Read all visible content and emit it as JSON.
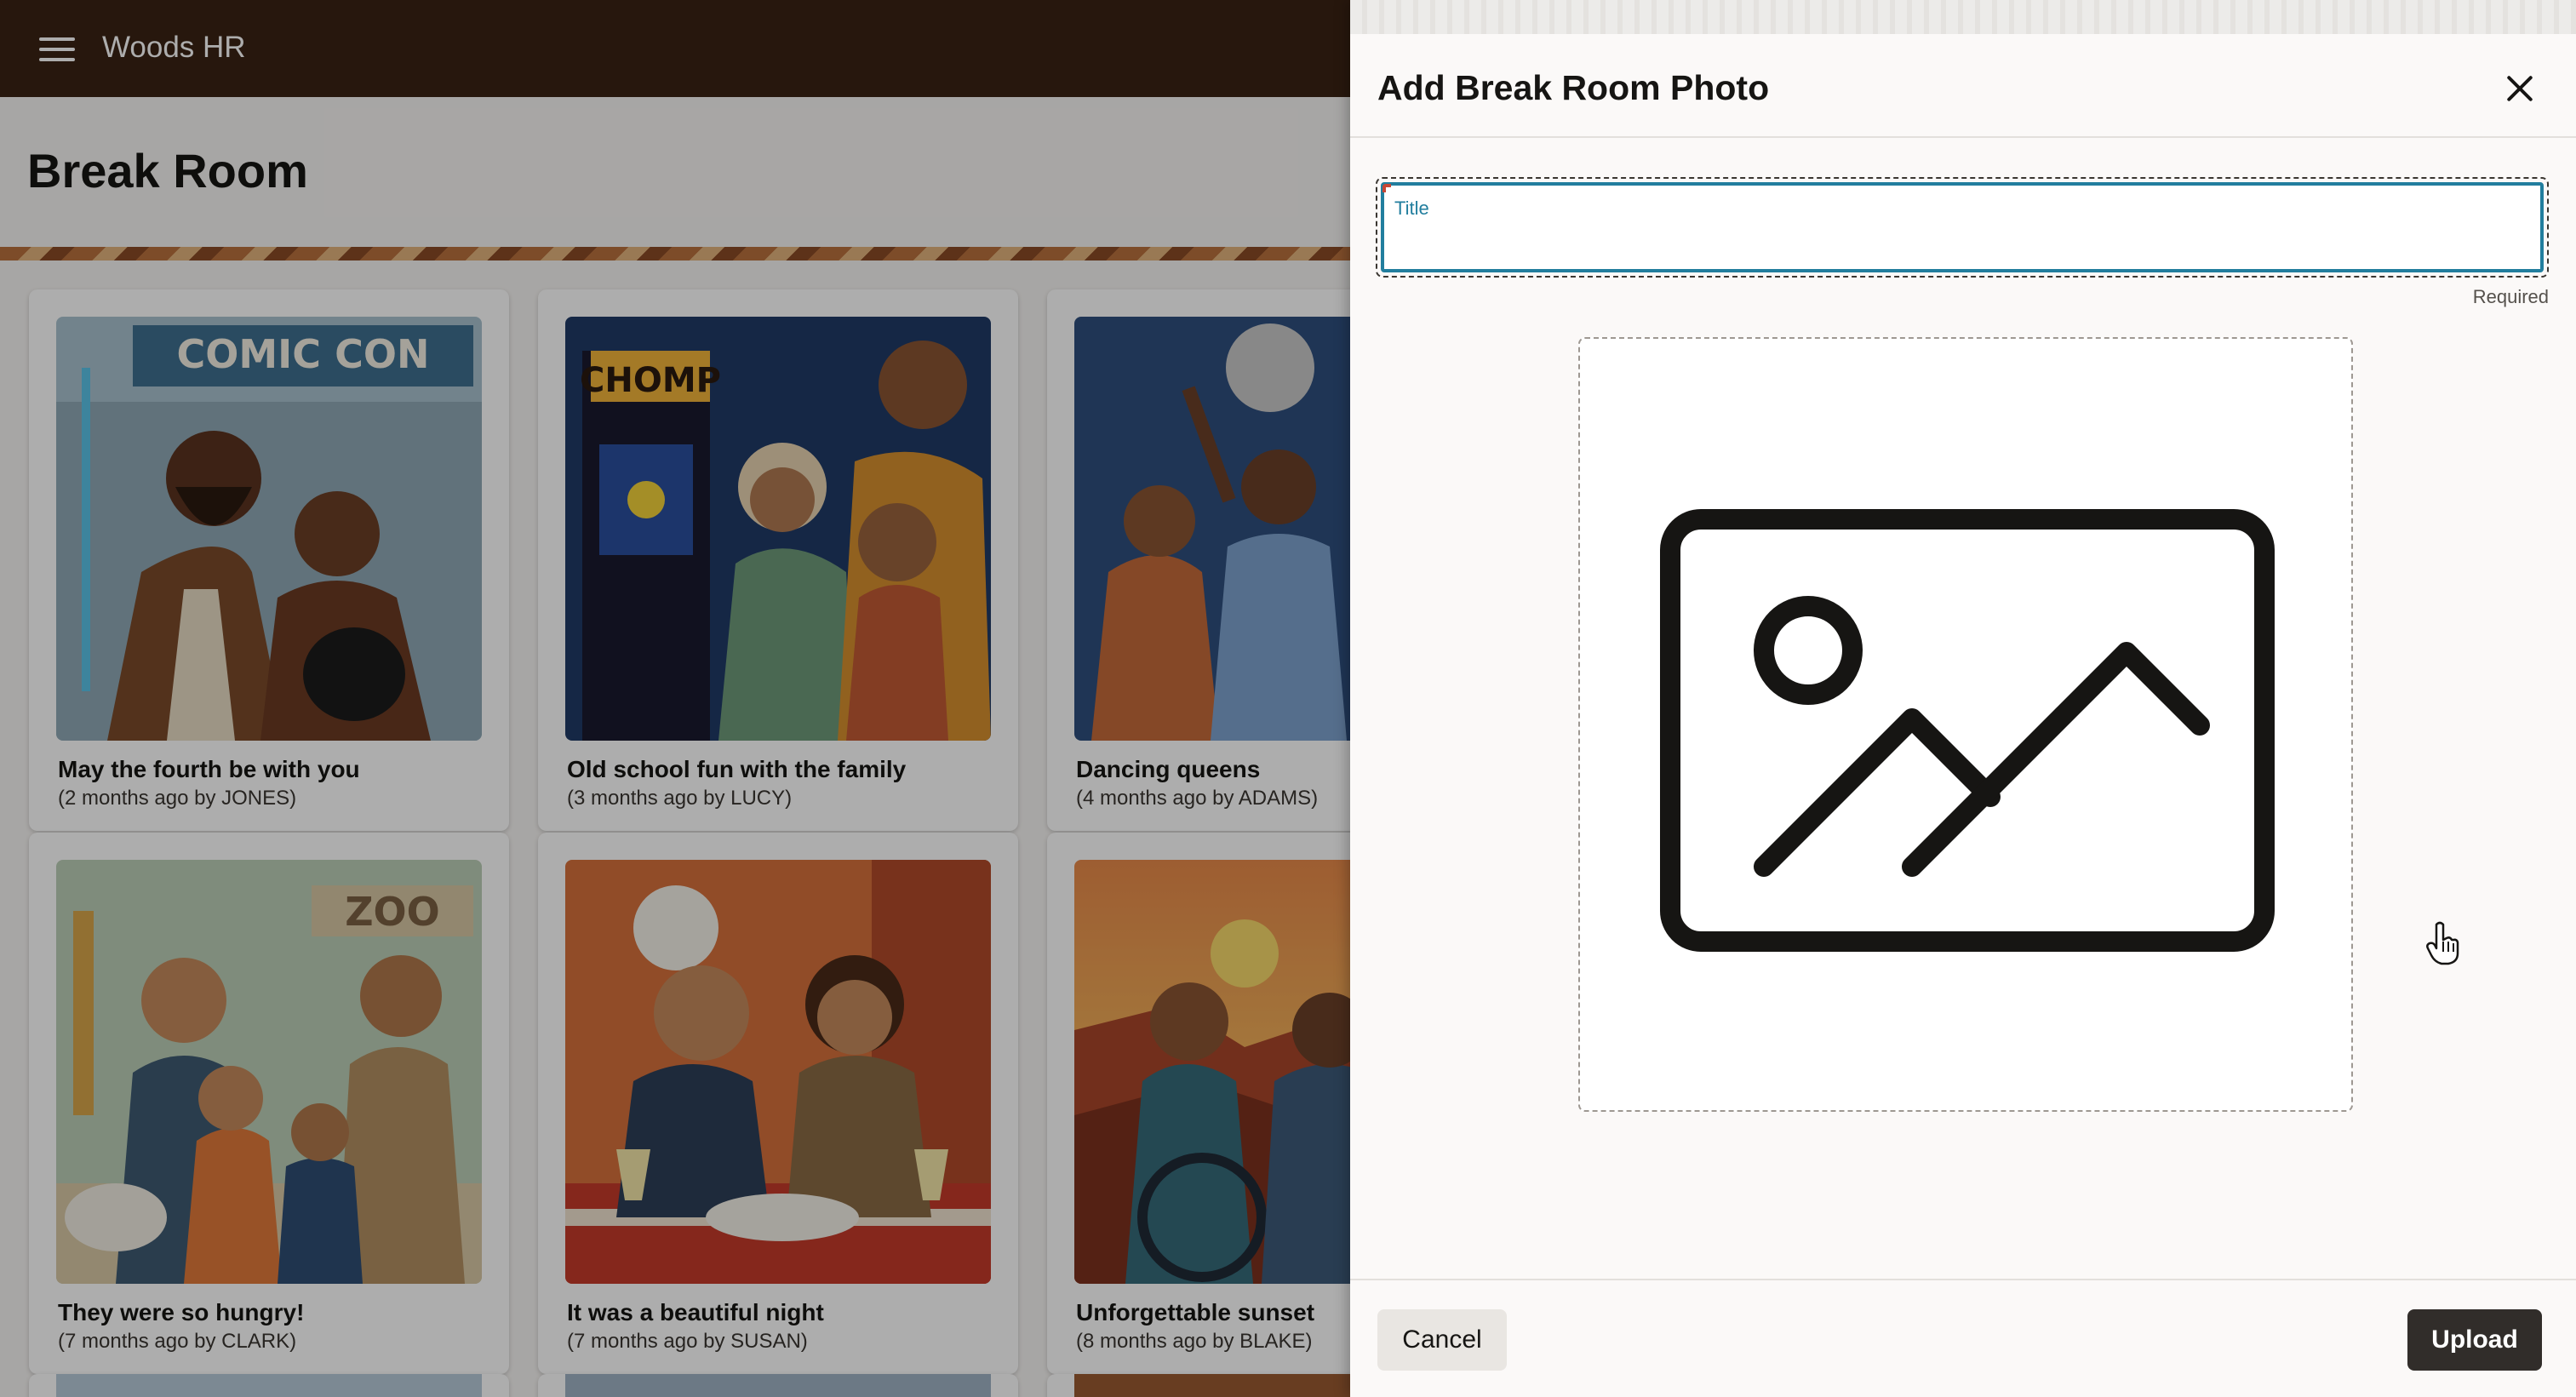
{
  "app": {
    "brand": "Woods HR",
    "page_title": "Break Room"
  },
  "cards": [
    {
      "title": "May the fourth be with you",
      "meta": "(2 months ago by JONES)",
      "illustration": "comic-con"
    },
    {
      "title": "Old school fun with the family",
      "meta": "(3 months ago by LUCY)",
      "illustration": "arcade",
      "sign": "CHOMP"
    },
    {
      "title": "Dancing queens",
      "meta": "(4 months ago by ADAMS)",
      "illustration": "disco"
    },
    {
      "title": "They were so hungry!",
      "meta": "(7 months ago by CLARK)",
      "illustration": "zoo",
      "sign": "ZOO"
    },
    {
      "title": "It was a beautiful night",
      "meta": "(7 months ago by SUSAN)",
      "illustration": "dinner"
    },
    {
      "title": "Unforgettable sunset",
      "meta": "(8 months ago by BLAKE)",
      "illustration": "sunset"
    }
  ],
  "card_signs": {
    "comic": "COMIC CON"
  },
  "drawer": {
    "title": "Add Break Room Photo",
    "title_field": {
      "label": "Title",
      "value": "",
      "helper": "Required"
    },
    "dropzone_icon": "image-placeholder-icon",
    "cancel_label": "Cancel",
    "upload_label": "Upload"
  },
  "colors": {
    "topbar": "#3a2314",
    "field_focus": "#227e9e",
    "primary_button": "#312d2a"
  }
}
